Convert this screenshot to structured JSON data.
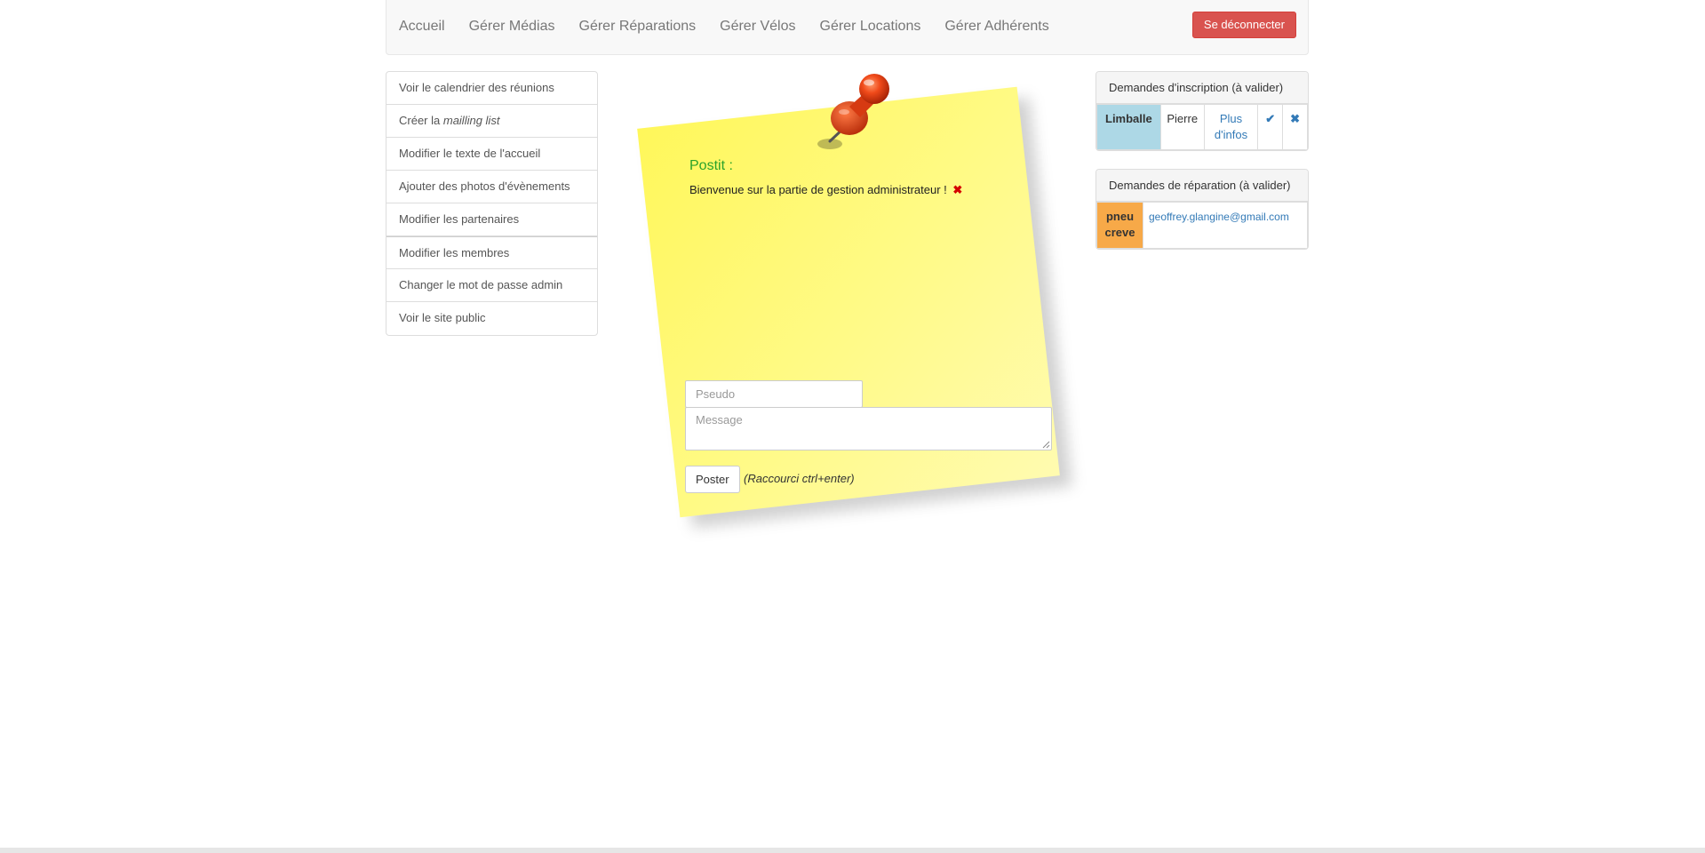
{
  "navbar": {
    "links": [
      "Accueil",
      "Gérer Médias",
      "Gérer Réparations",
      "Gérer Vélos",
      "Gérer Locations",
      "Gérer Adhérents"
    ],
    "logout_label": "Se déconnecter",
    "logout_color": "#d9534f"
  },
  "sidebar": {
    "items": [
      {
        "label": "Voir le calendrier des réunions"
      },
      {
        "label_prefix": "Créer la ",
        "label_em": "mailling list"
      },
      {
        "label": "Modifier le texte de l'accueil"
      },
      {
        "label": "Ajouter des photos d'évènements"
      },
      {
        "label": "Modifier les partenaires"
      },
      {
        "label": "Modifier les membres"
      },
      {
        "label": "Changer le mot de passe admin"
      },
      {
        "label": "Voir le site public"
      }
    ]
  },
  "postit": {
    "title": "Postit :",
    "message": "Bienvenue sur la partie de gestion administrateur !",
    "delete_icon": "✖",
    "pseudo_placeholder": "Pseudo",
    "message_placeholder": "Message",
    "submit_label": "Poster",
    "shortcut_hint": "(Raccourci ctrl+enter)",
    "paper_color": "#fff75a",
    "title_color": "#2ba32b"
  },
  "inscriptions": {
    "heading": "Demandes d'inscription (à valider)",
    "rows": [
      {
        "last_name": "Limballe",
        "first_name": "Pierre",
        "more_info": "Plus d'infos",
        "accept_icon": "✔",
        "reject_icon": "✖"
      }
    ]
  },
  "reparations": {
    "heading": "Demandes de réparation (à valider)",
    "rows": [
      {
        "problem": "pneu creve",
        "email": "geoffrey.glangine@gmail.com"
      }
    ]
  }
}
